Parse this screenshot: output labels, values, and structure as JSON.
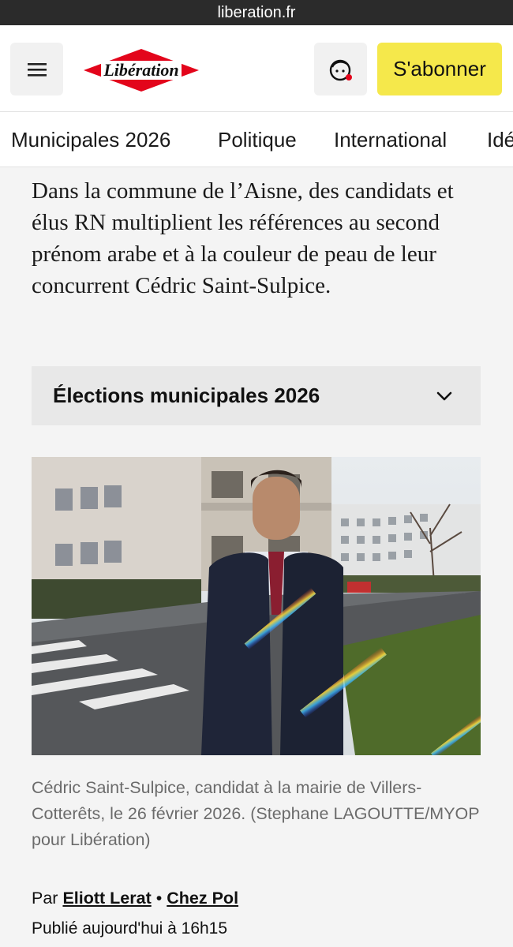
{
  "browser": {
    "url": "liberation.fr"
  },
  "header": {
    "logo_text": "Libération",
    "subscribe_label": "S'abonner",
    "colors": {
      "brand_red": "#e3051b",
      "subscribe_yellow": "#f5e84b"
    }
  },
  "nav": {
    "items": [
      {
        "label": "Municipales 2026"
      },
      {
        "label": "Politique"
      },
      {
        "label": "International"
      },
      {
        "label": "Idé"
      }
    ]
  },
  "article": {
    "lead": "Dans la commune de l’Aisne, des candidats et élus RN multiplient les références au second prénom arabe et à la couleur de peau de leur concurrent Cédric Saint-Sulpice.",
    "dossier_label": "Élections municipales 2026",
    "photo_caption": "Cédric Saint-Sulpice, candidat à la mairie de Villers-Cotterêts, le 26 février 2026. (Stephane LAGOUTTE/MYOP pour Libération)",
    "byline_prefix": "Par",
    "author": "Eliott Lerat",
    "byline_sep": "•",
    "section": "Chez Pol",
    "published": "Publié aujourd'hui à 16h15"
  }
}
